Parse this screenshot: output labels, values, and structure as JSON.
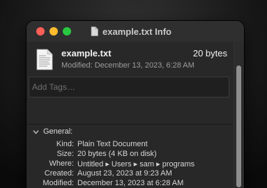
{
  "window": {
    "title": "example.txt Info"
  },
  "file": {
    "name": "example.txt",
    "size": "20 bytes",
    "modified": "Modified: December 13, 2023, 6:28 AM"
  },
  "tags": {
    "placeholder": "Add Tags…"
  },
  "general": {
    "label": "General:",
    "rows": [
      {
        "key": "Kind:",
        "value": "Plain Text Document"
      },
      {
        "key": "Size:",
        "value": "20 bytes (4 KB on disk)"
      },
      {
        "key": "Where:",
        "value": "Untitled ▸ Users ▸ sam ▸ programs"
      },
      {
        "key": "Created:",
        "value": "August 23, 2023 at 9:23 AM"
      },
      {
        "key": "Modified:",
        "value": "December 13, 2023 at 6:28 AM"
      }
    ]
  },
  "colors": {
    "close": "#fe5f57",
    "minimize": "#febc2e",
    "zoom": "#28c840",
    "window_bg": "#282828"
  },
  "icons": {
    "title": "document-icon",
    "file": "text-file-icon",
    "disclosure": "chevron-down-icon"
  }
}
